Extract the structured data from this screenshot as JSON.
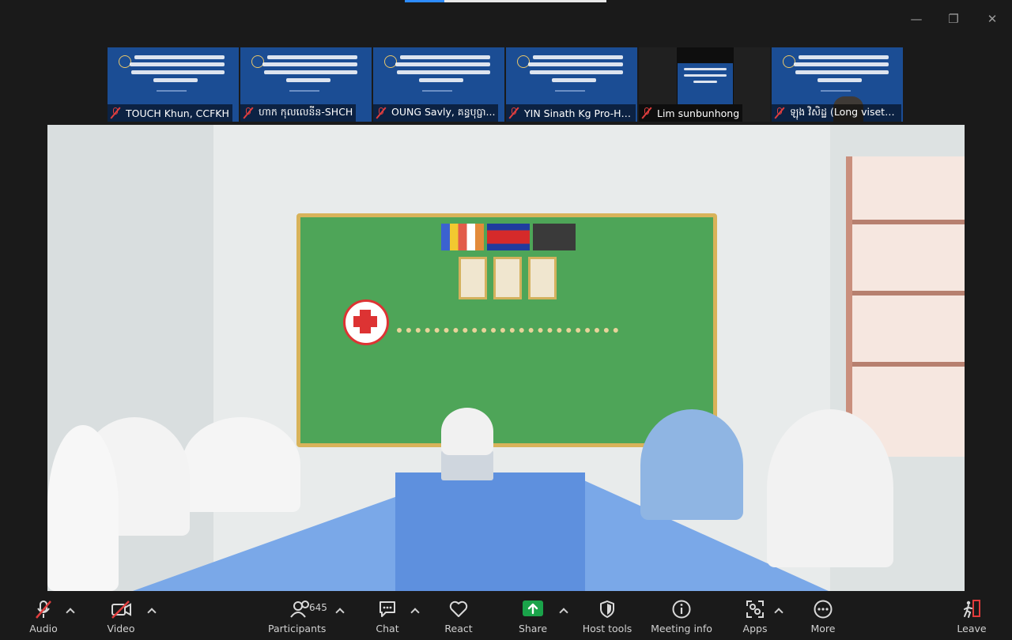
{
  "participants_strip": [
    {
      "name": "TOUCH Khun, CCFKH",
      "muted": true,
      "kind": "slide"
    },
    {
      "name": "ហាក កុលលេនីន-SHCH",
      "muted": true,
      "kind": "slide"
    },
    {
      "name": "OUNG Savly, គន្ធបុប្ផា...",
      "muted": true,
      "kind": "slide"
    },
    {
      "name": "YIN Sinath Kg Pro-Hos...",
      "muted": true,
      "kind": "slide"
    },
    {
      "name": "Lim sunbunhong",
      "muted": true,
      "kind": "screen"
    },
    {
      "name": "ឡុង វិសិដ្ឋ (Long viseth)...",
      "muted": true,
      "kind": "slide-person"
    }
  ],
  "toolbar": {
    "audio": "Audio",
    "video": "Video",
    "participants": "Participants",
    "participants_count": "645",
    "chat": "Chat",
    "react": "React",
    "share": "Share",
    "host_tools": "Host tools",
    "meeting_info": "Meeting info",
    "apps": "Apps",
    "more": "More",
    "leave": "Leave"
  },
  "colors": {
    "muted_red": "#e03e3e",
    "share_green": "#1aa34a",
    "leave_red": "#e23b3b",
    "tile_blue": "#1b4d94"
  }
}
